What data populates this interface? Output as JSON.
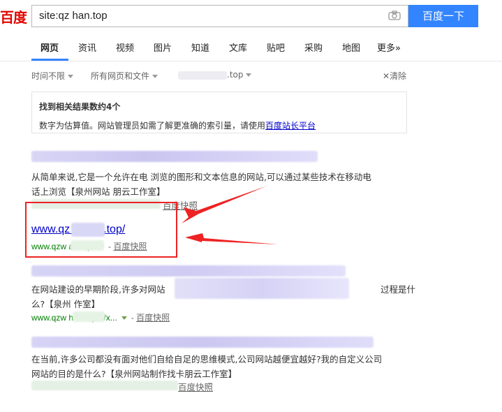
{
  "header": {
    "logo": "百度",
    "query": "site:qz    han.top",
    "search_button": "百度一下"
  },
  "nav": {
    "tabs": [
      "网页",
      "资讯",
      "视频",
      "图片",
      "知道",
      "文库",
      "贴吧",
      "采购",
      "地图",
      "更多»"
    ]
  },
  "tools": {
    "time": "时间不限",
    "type": "所有网页和文件",
    "site": ".top",
    "clear": "清除"
  },
  "infobox": {
    "title": "找到相关结果数约4个",
    "text": "数字为估算值。网站管理员如需了解更准确的索引量，请使用",
    "link": "百度站长平台"
  },
  "results": [
    {
      "snippet_line1": "从简单来说,它是一个允许在电      浏览的图形和文本信息的网站,可以通过某些技术在移动电",
      "snippet_line2": "话上浏览【泉州网站          朋云工作室】",
      "snapshot": "百度快照"
    },
    {
      "title": "www.qz      gzhan.top/",
      "url": "www.qzw        an.top/",
      "snapshot": "百度快照"
    },
    {
      "snippet_line1": "在网站建设的早期阶段,许多对网站",
      "snippet_tail": "过程是什",
      "snippet_line2": "么?【泉州          作室】",
      "url": "www.qzw        han.top/a/x...",
      "snapshot": "百度快照"
    },
    {
      "snippet_line1": "在当前,许多公司都没有面对他们自给自足的思维模式,公司网站越便宜越好?我的自定义公司",
      "snippet_line2": "网站的目的是什么?【泉州网站制作找卡朋云工作室】",
      "snapshot": "百度快照"
    }
  ],
  "colors": {
    "brand_red": "#e10602",
    "link_blue": "#0000cc",
    "button_blue": "#3385ff",
    "url_green": "#008000",
    "annotation_red": "#ee2222"
  }
}
